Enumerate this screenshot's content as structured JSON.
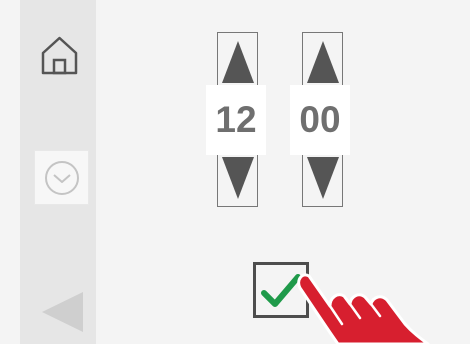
{
  "time_picker": {
    "hour": "12",
    "minute": "00"
  },
  "icons": {
    "home": "home-icon",
    "clock": "clock-icon",
    "back": "back-arrow-icon",
    "up": "triangle-up-icon",
    "down": "triangle-down-icon",
    "confirm": "checkmark-icon",
    "pointer": "hand-pointer-icon"
  },
  "colors": {
    "confirm_check": "#1f9a4a",
    "hand_fill": "#d71f2f",
    "panel": "#f4f4f4",
    "sidebar": "#e6e6e6"
  }
}
